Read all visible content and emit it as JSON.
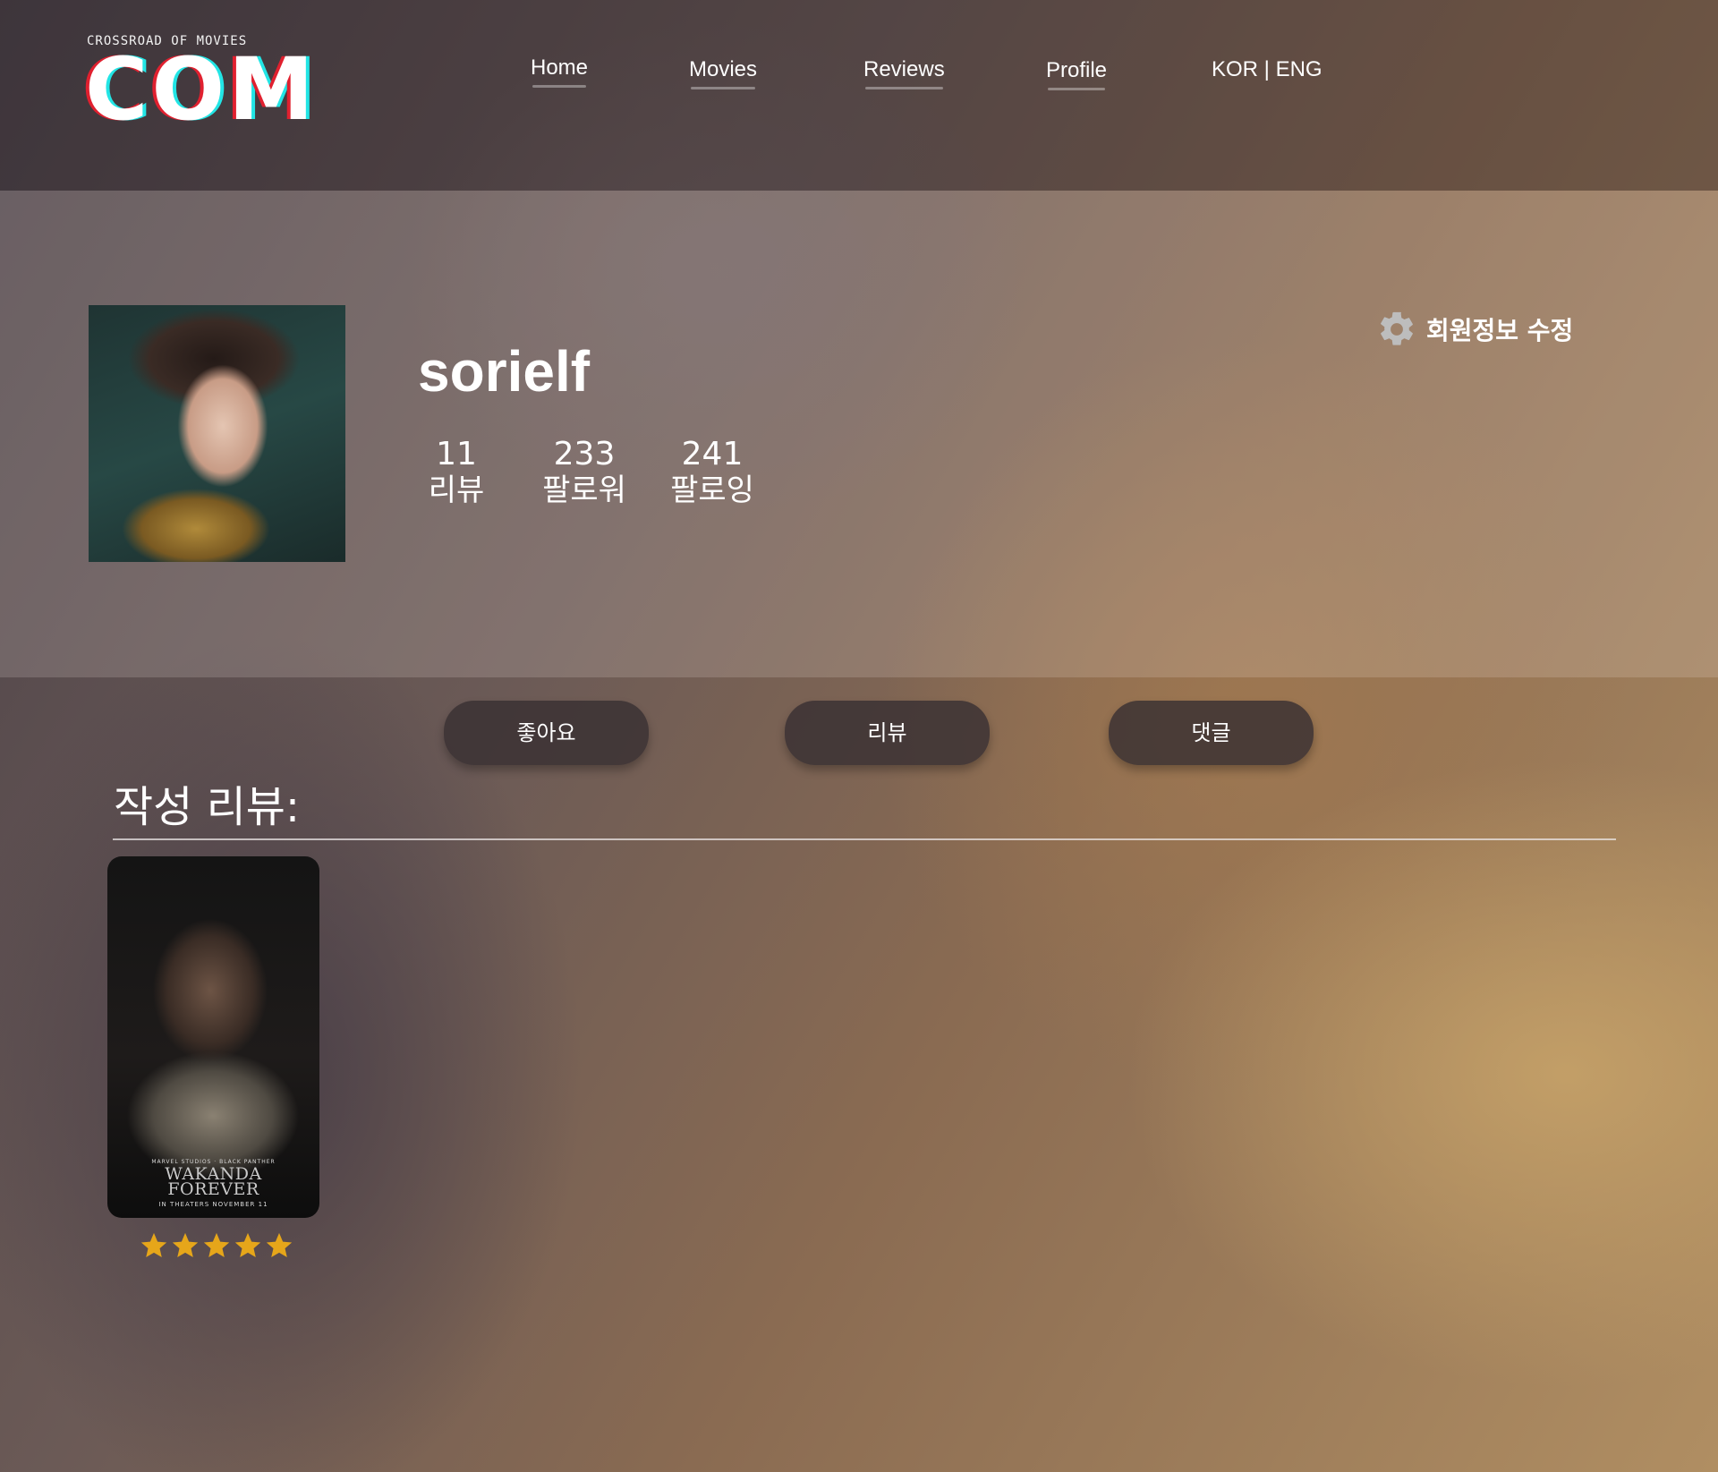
{
  "header": {
    "logo_tagline": "CROSSROAD OF MOVIES",
    "logo_text": "COM",
    "nav": [
      {
        "label": "Home"
      },
      {
        "label": "Movies"
      },
      {
        "label": "Reviews"
      },
      {
        "label": "Profile"
      },
      {
        "label": "KOR | ENG"
      }
    ]
  },
  "profile": {
    "username": "sorielf",
    "stats": [
      {
        "value": "11",
        "label": "리뷰"
      },
      {
        "value": "233",
        "label": "팔로워"
      },
      {
        "value": "241",
        "label": "팔로잉"
      }
    ],
    "edit_label": "회원정보 수정"
  },
  "tabs": [
    {
      "label": "좋아요"
    },
    {
      "label": "리뷰"
    },
    {
      "label": "댓글"
    }
  ],
  "reviews_section": {
    "title": "작성 리뷰:",
    "items": [
      {
        "poster_brand": "MARVEL STUDIOS · BLACK PANTHER",
        "poster_title_line1": "WAKANDA",
        "poster_title_line2": "FOREVER",
        "poster_release": "IN THEATERS NOVEMBER 11",
        "rating": 5,
        "rating_max": 5
      }
    ]
  },
  "colors": {
    "star": "#e6a61a",
    "logo_red": "#e0202f",
    "logo_cyan": "#22e5e5"
  }
}
